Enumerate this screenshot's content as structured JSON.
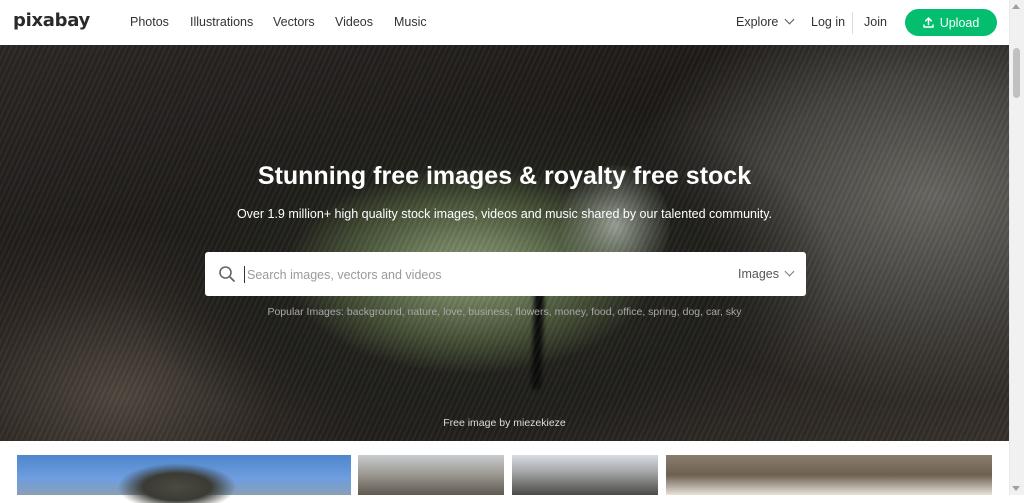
{
  "header": {
    "logo": "pixabay",
    "nav": [
      "Photos",
      "Illustrations",
      "Vectors",
      "Videos",
      "Music"
    ],
    "explore_label": "Explore",
    "login_label": "Log in",
    "join_label": "Join",
    "upload_label": "Upload",
    "accent_color": "#02be6e"
  },
  "hero": {
    "title": "Stunning free images & royalty free stock",
    "subtitle": "Over 1.9 million+ high quality stock images, videos and music shared by our talented community.",
    "search": {
      "placeholder": "Search images, vectors and videos",
      "value": "",
      "type_selected": "Images"
    },
    "popular": "Popular Images: background, nature, love, business, flowers, money, food, office, spring, dog, car, sky",
    "credit": "Free image by miezekieze"
  }
}
